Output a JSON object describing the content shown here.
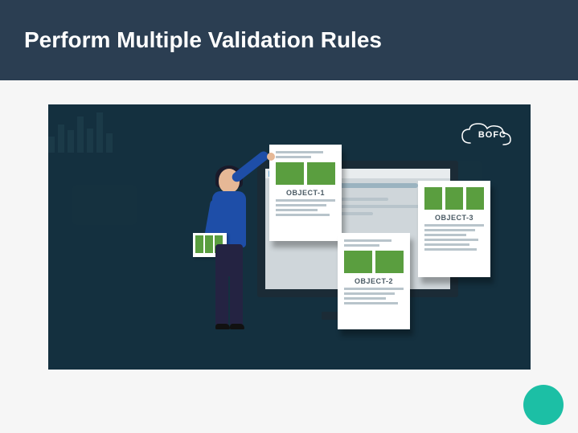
{
  "header": {
    "title": "Perform Multiple Validation Rules"
  },
  "logo": {
    "text": "BOFC"
  },
  "documents": [
    {
      "label": "OBJECT-1"
    },
    {
      "label": "OBJECT-2"
    },
    {
      "label": "OBJECT-3"
    }
  ],
  "colors": {
    "headerBg": "#2b3e52",
    "illustrationBg": "#14303f",
    "accentGreen": "#5a9e3f",
    "fab": "#1cbfa5",
    "personShirt": "#1e4ea8"
  }
}
